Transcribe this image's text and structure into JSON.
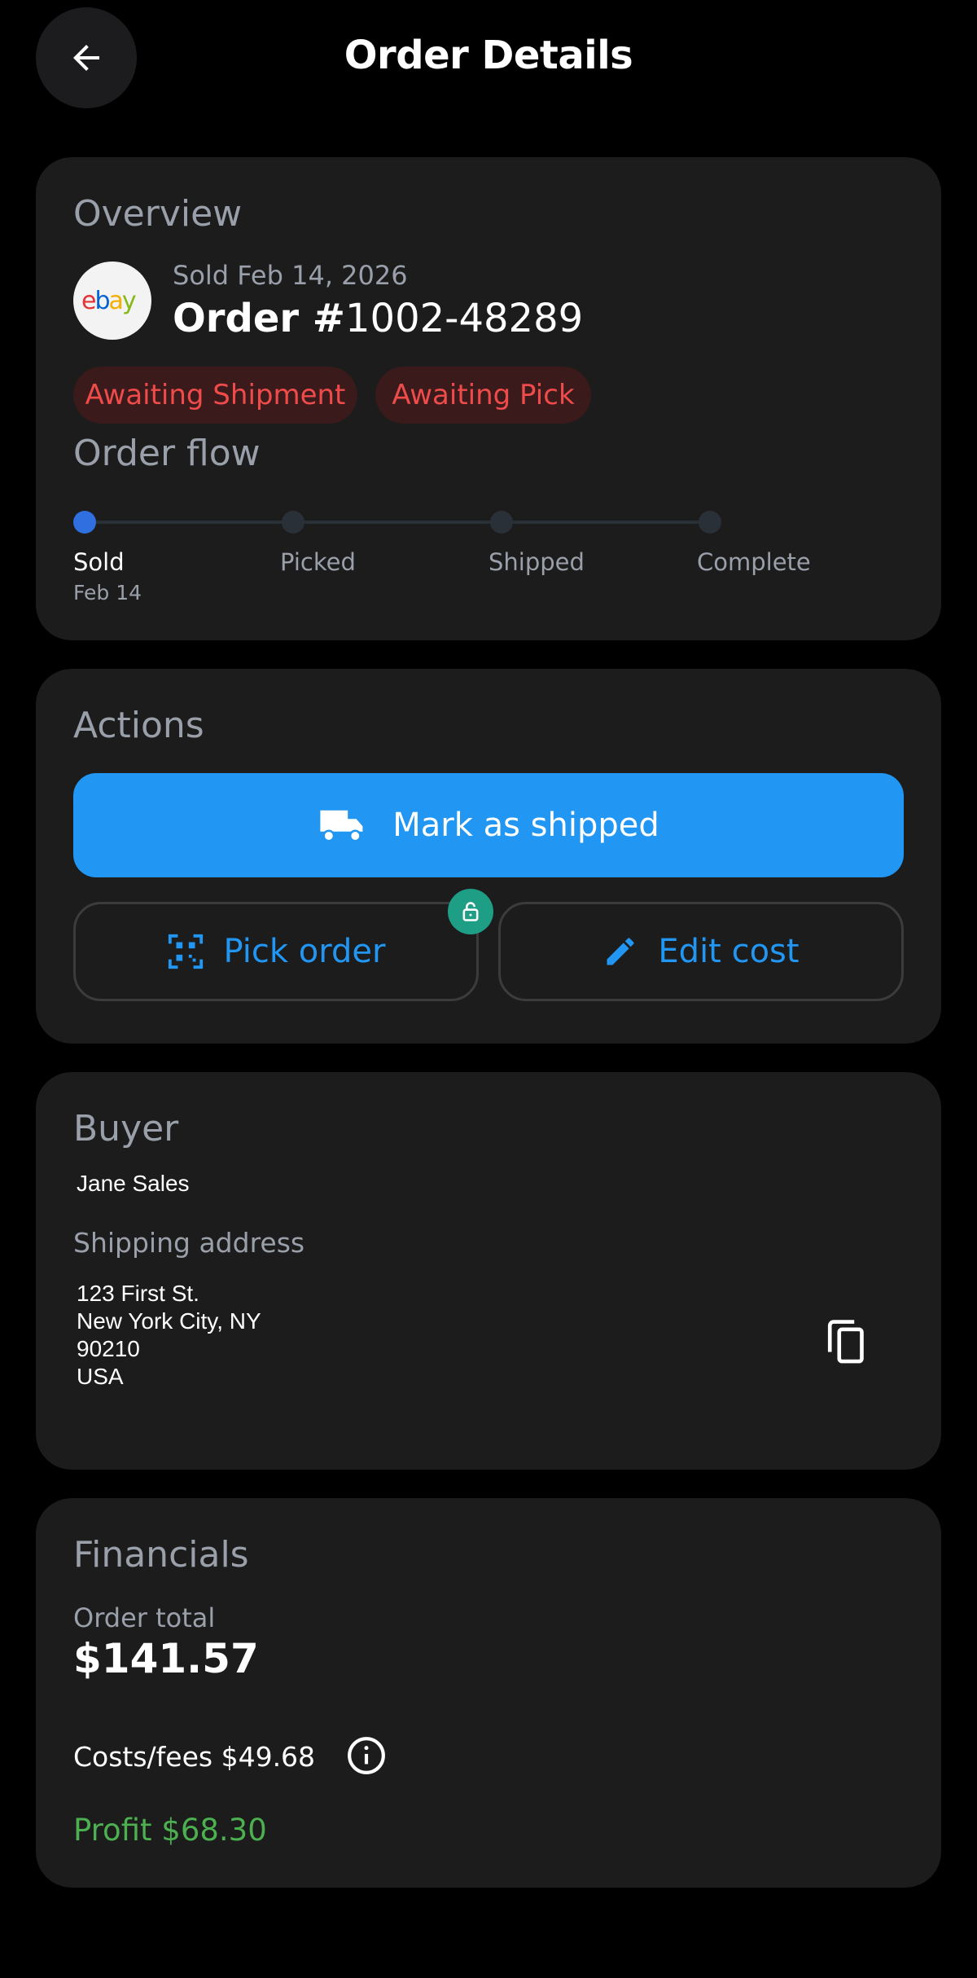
{
  "header": {
    "title": "Order Details"
  },
  "overview": {
    "section_title": "Overview",
    "marketplace_logo_text": "ebay",
    "sold_date": "Sold Feb 14, 2026",
    "order_prefix": "Order #",
    "order_number": "1002-48289",
    "chips": [
      "Awaiting Shipment",
      "Awaiting Pick"
    ],
    "flow_title": "Order flow",
    "flow_steps": [
      {
        "label": "Sold",
        "date": "Feb 14",
        "active": true
      },
      {
        "label": "Picked",
        "date": "",
        "active": false
      },
      {
        "label": "Shipped",
        "date": "",
        "active": false
      },
      {
        "label": "Complete",
        "date": "",
        "active": false
      }
    ]
  },
  "actions": {
    "section_title": "Actions",
    "primary_label": "Mark as shipped",
    "primary_icon": "truck-icon",
    "pick_label": "Pick order",
    "pick_icon": "qr-code-scan-icon",
    "pick_badge_icon": "lock-open-icon",
    "edit_label": "Edit cost",
    "edit_icon": "pencil-icon"
  },
  "buyer": {
    "section_title": "Buyer",
    "name": "Jane Sales",
    "address_title": "Shipping address",
    "address_lines": [
      "123 First St.",
      "New York City, NY",
      "90210",
      "USA"
    ],
    "copy_icon": "copy-icon"
  },
  "financials": {
    "section_title": "Financials",
    "order_total_label": "Order total",
    "order_total_value": "$141.57",
    "costs_label": "Costs/fees $49.68",
    "info_icon": "info-icon",
    "profit_label": "Profit $68.30"
  },
  "colors": {
    "background": "#000000",
    "card": "#1c1c1c",
    "accent_blue": "#2196f3",
    "chip_bg": "#3a1a1b",
    "chip_text": "#ef4b4b",
    "profit_green": "#4caf50",
    "badge_teal": "#1f9e86",
    "muted_text": "#9aa0aa"
  }
}
